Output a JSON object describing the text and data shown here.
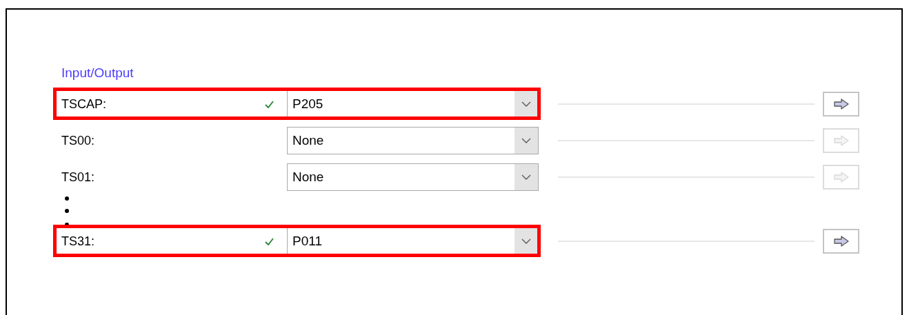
{
  "section": {
    "title": "Input/Output"
  },
  "rows": [
    {
      "kind": "row",
      "label": "TSCAP:",
      "valid": true,
      "value": "P205",
      "highlighted": true,
      "disabled": false
    },
    {
      "kind": "row",
      "label": "TS00:",
      "valid": false,
      "value": "None",
      "highlighted": false,
      "disabled": true
    },
    {
      "kind": "row",
      "label": "TS01:",
      "valid": false,
      "value": "None",
      "highlighted": false,
      "disabled": true
    },
    {
      "kind": "ellipsis"
    },
    {
      "kind": "row",
      "label": "TS31:",
      "valid": true,
      "value": "P011",
      "highlighted": true,
      "disabled": false
    }
  ]
}
